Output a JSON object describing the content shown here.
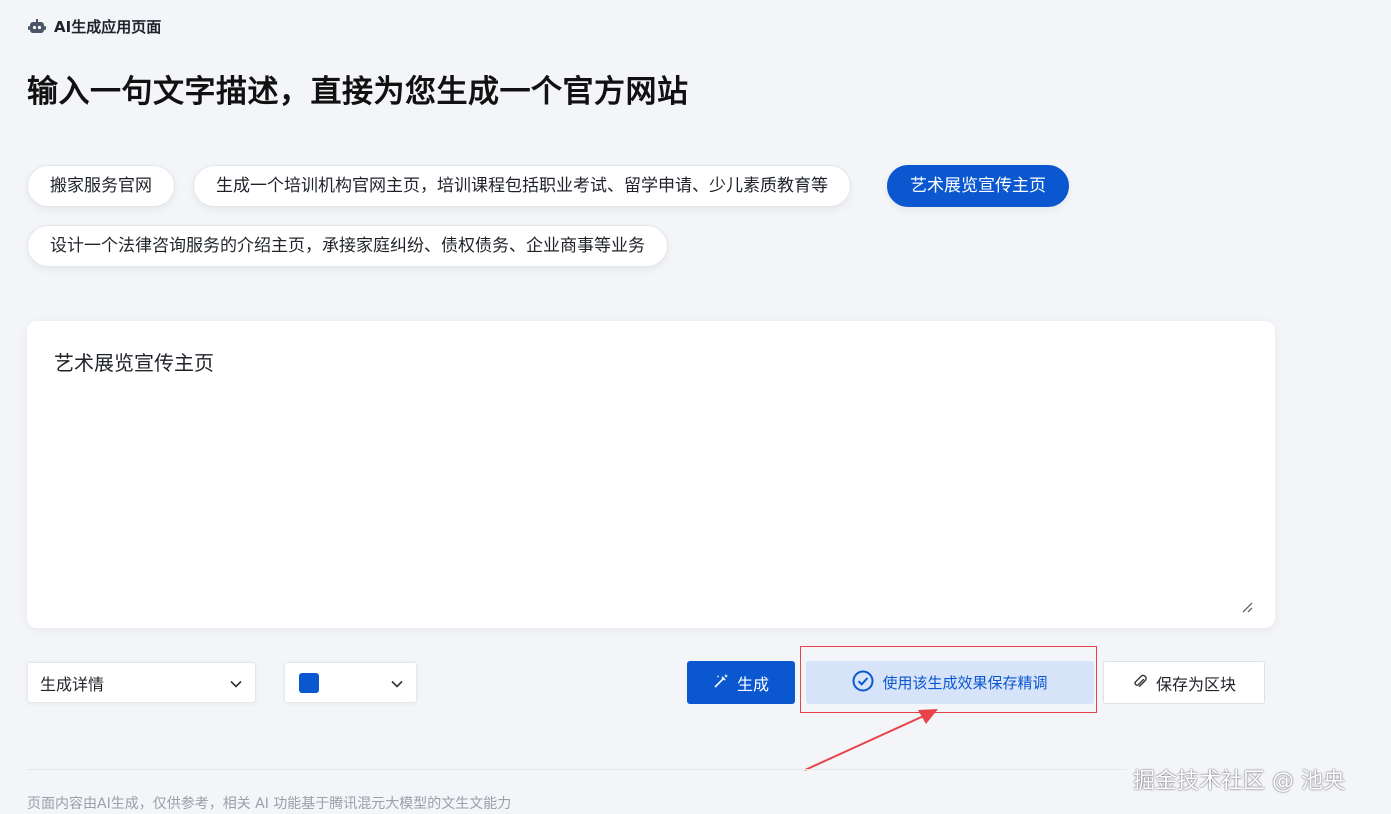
{
  "header": {
    "app_title": "AI生成应用页面",
    "icon": "robot-icon"
  },
  "page_title": "输入一句文字描述，直接为您生成一个官方网站",
  "suggestions": [
    {
      "label": "搬家服务官网",
      "active": false
    },
    {
      "label": "生成一个培训机构官网主页，培训课程包括职业考试、留学申请、少儿素质教育等",
      "active": false
    },
    {
      "label": "艺术展览宣传主页",
      "active": true
    },
    {
      "label": "设计一个法律咨询服务的介绍主页，承接家庭纠纷、债权债务、企业商事等业务",
      "active": false
    }
  ],
  "prompt": {
    "value": "艺术展览宣传主页"
  },
  "controls": {
    "detail_select": {
      "value": "生成详情"
    },
    "color_select": {
      "value_color": "#0b57d0"
    }
  },
  "actions": {
    "generate_label": "生成",
    "save_tune_label": "使用该生成效果保存精调",
    "save_block_label": "保存为区块"
  },
  "footer": {
    "note": "页面内容由AI生成，仅供参考，相关 AI 功能基于腾讯混元大模型的文生文能力"
  },
  "watermark": "掘金技术社区 @ 池央",
  "colors": {
    "primary": "#0b57d0",
    "annotation": "#e8434b"
  }
}
